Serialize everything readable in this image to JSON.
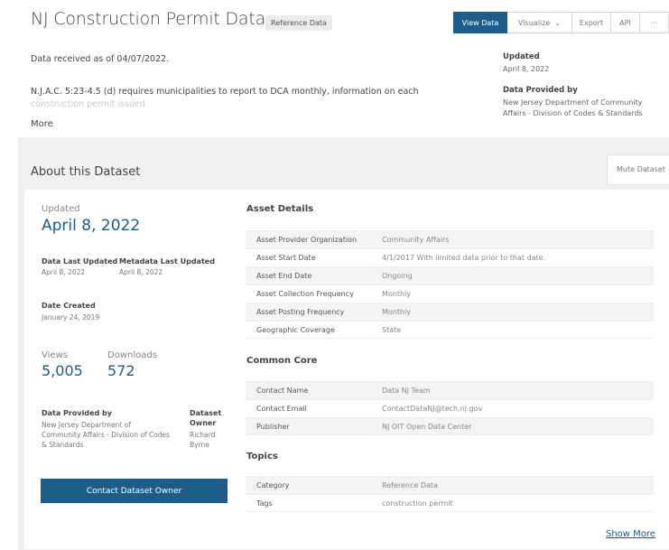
{
  "header": {
    "title": "NJ Construction Permit Data",
    "badge": "Reference Data",
    "toolbar": {
      "view_data": "View Data",
      "visualize": "Visualize",
      "export": "Export",
      "api": "API",
      "more": "···"
    }
  },
  "summary": {
    "received": "Data received as of 04/07/2022.",
    "line1": "N.J.A.C. 5:23-4.5 (d) requires municipalities to report to DCA monthly, information on each",
    "line2": "construction permit issued.",
    "more": "More",
    "updated_label": "Updated",
    "updated_value": "April 8, 2022",
    "provided_label": "Data Provided by",
    "provided_line1": "New Jersey Department of Community",
    "provided_line2": "Affairs - Division of Codes & Standards"
  },
  "about": {
    "title": "About this Dataset",
    "mute": "Mute Dataset",
    "updated_label": "Updated",
    "updated_value": "April 8, 2022",
    "data_last_updated_label": "Data Last Updated",
    "data_last_updated_value": "April 8, 2022",
    "metadata_last_updated_label": "Metadata Last Updated",
    "metadata_last_updated_value": "April 8, 2022",
    "date_created_label": "Date Created",
    "date_created_value": "January 24, 2019",
    "views_label": "Views",
    "views_value": "5,005",
    "downloads_label": "Downloads",
    "downloads_value": "572",
    "provided_label": "Data Provided by",
    "provided_line1": "New Jersey Department of",
    "provided_line2": "Community Affairs - Division of Codes",
    "provided_line3": "& Standards",
    "owner_label_1": "Dataset",
    "owner_label_2": "Owner",
    "owner_line1": "Richard",
    "owner_line2": "Byrne",
    "contact_button": "Contact Dataset Owner",
    "show_more": "Show More"
  },
  "asset_details": {
    "title": "Asset Details",
    "rows": [
      {
        "key": "Asset Provider Organization",
        "value": "Community Affairs"
      },
      {
        "key": "Asset Start Date",
        "value": "4/1/2017 With limited data prior to that date."
      },
      {
        "key": "Asset End Date",
        "value": "Ongoing"
      },
      {
        "key": "Asset Collection Frequency",
        "value": "Monthly"
      },
      {
        "key": "Asset Posting Frequency",
        "value": "Monthly"
      },
      {
        "key": "Geographic Coverage",
        "value": "State"
      }
    ]
  },
  "common_core": {
    "title": "Common Core",
    "rows": [
      {
        "key": "Contact Name",
        "value": "Data NJ Team"
      },
      {
        "key": "Contact Email",
        "value": "ContactDataNJ@tech.nj.gov"
      },
      {
        "key": "Publisher",
        "value": "NJ OIT Open Data Center"
      }
    ]
  },
  "topics": {
    "title": "Topics",
    "rows": [
      {
        "key": "Category",
        "value": "Reference Data"
      },
      {
        "key": "Tags",
        "value": "construction permit"
      }
    ]
  },
  "colors": {
    "accent": "#1e5c8a",
    "section_bg": "#f1f1f1"
  }
}
